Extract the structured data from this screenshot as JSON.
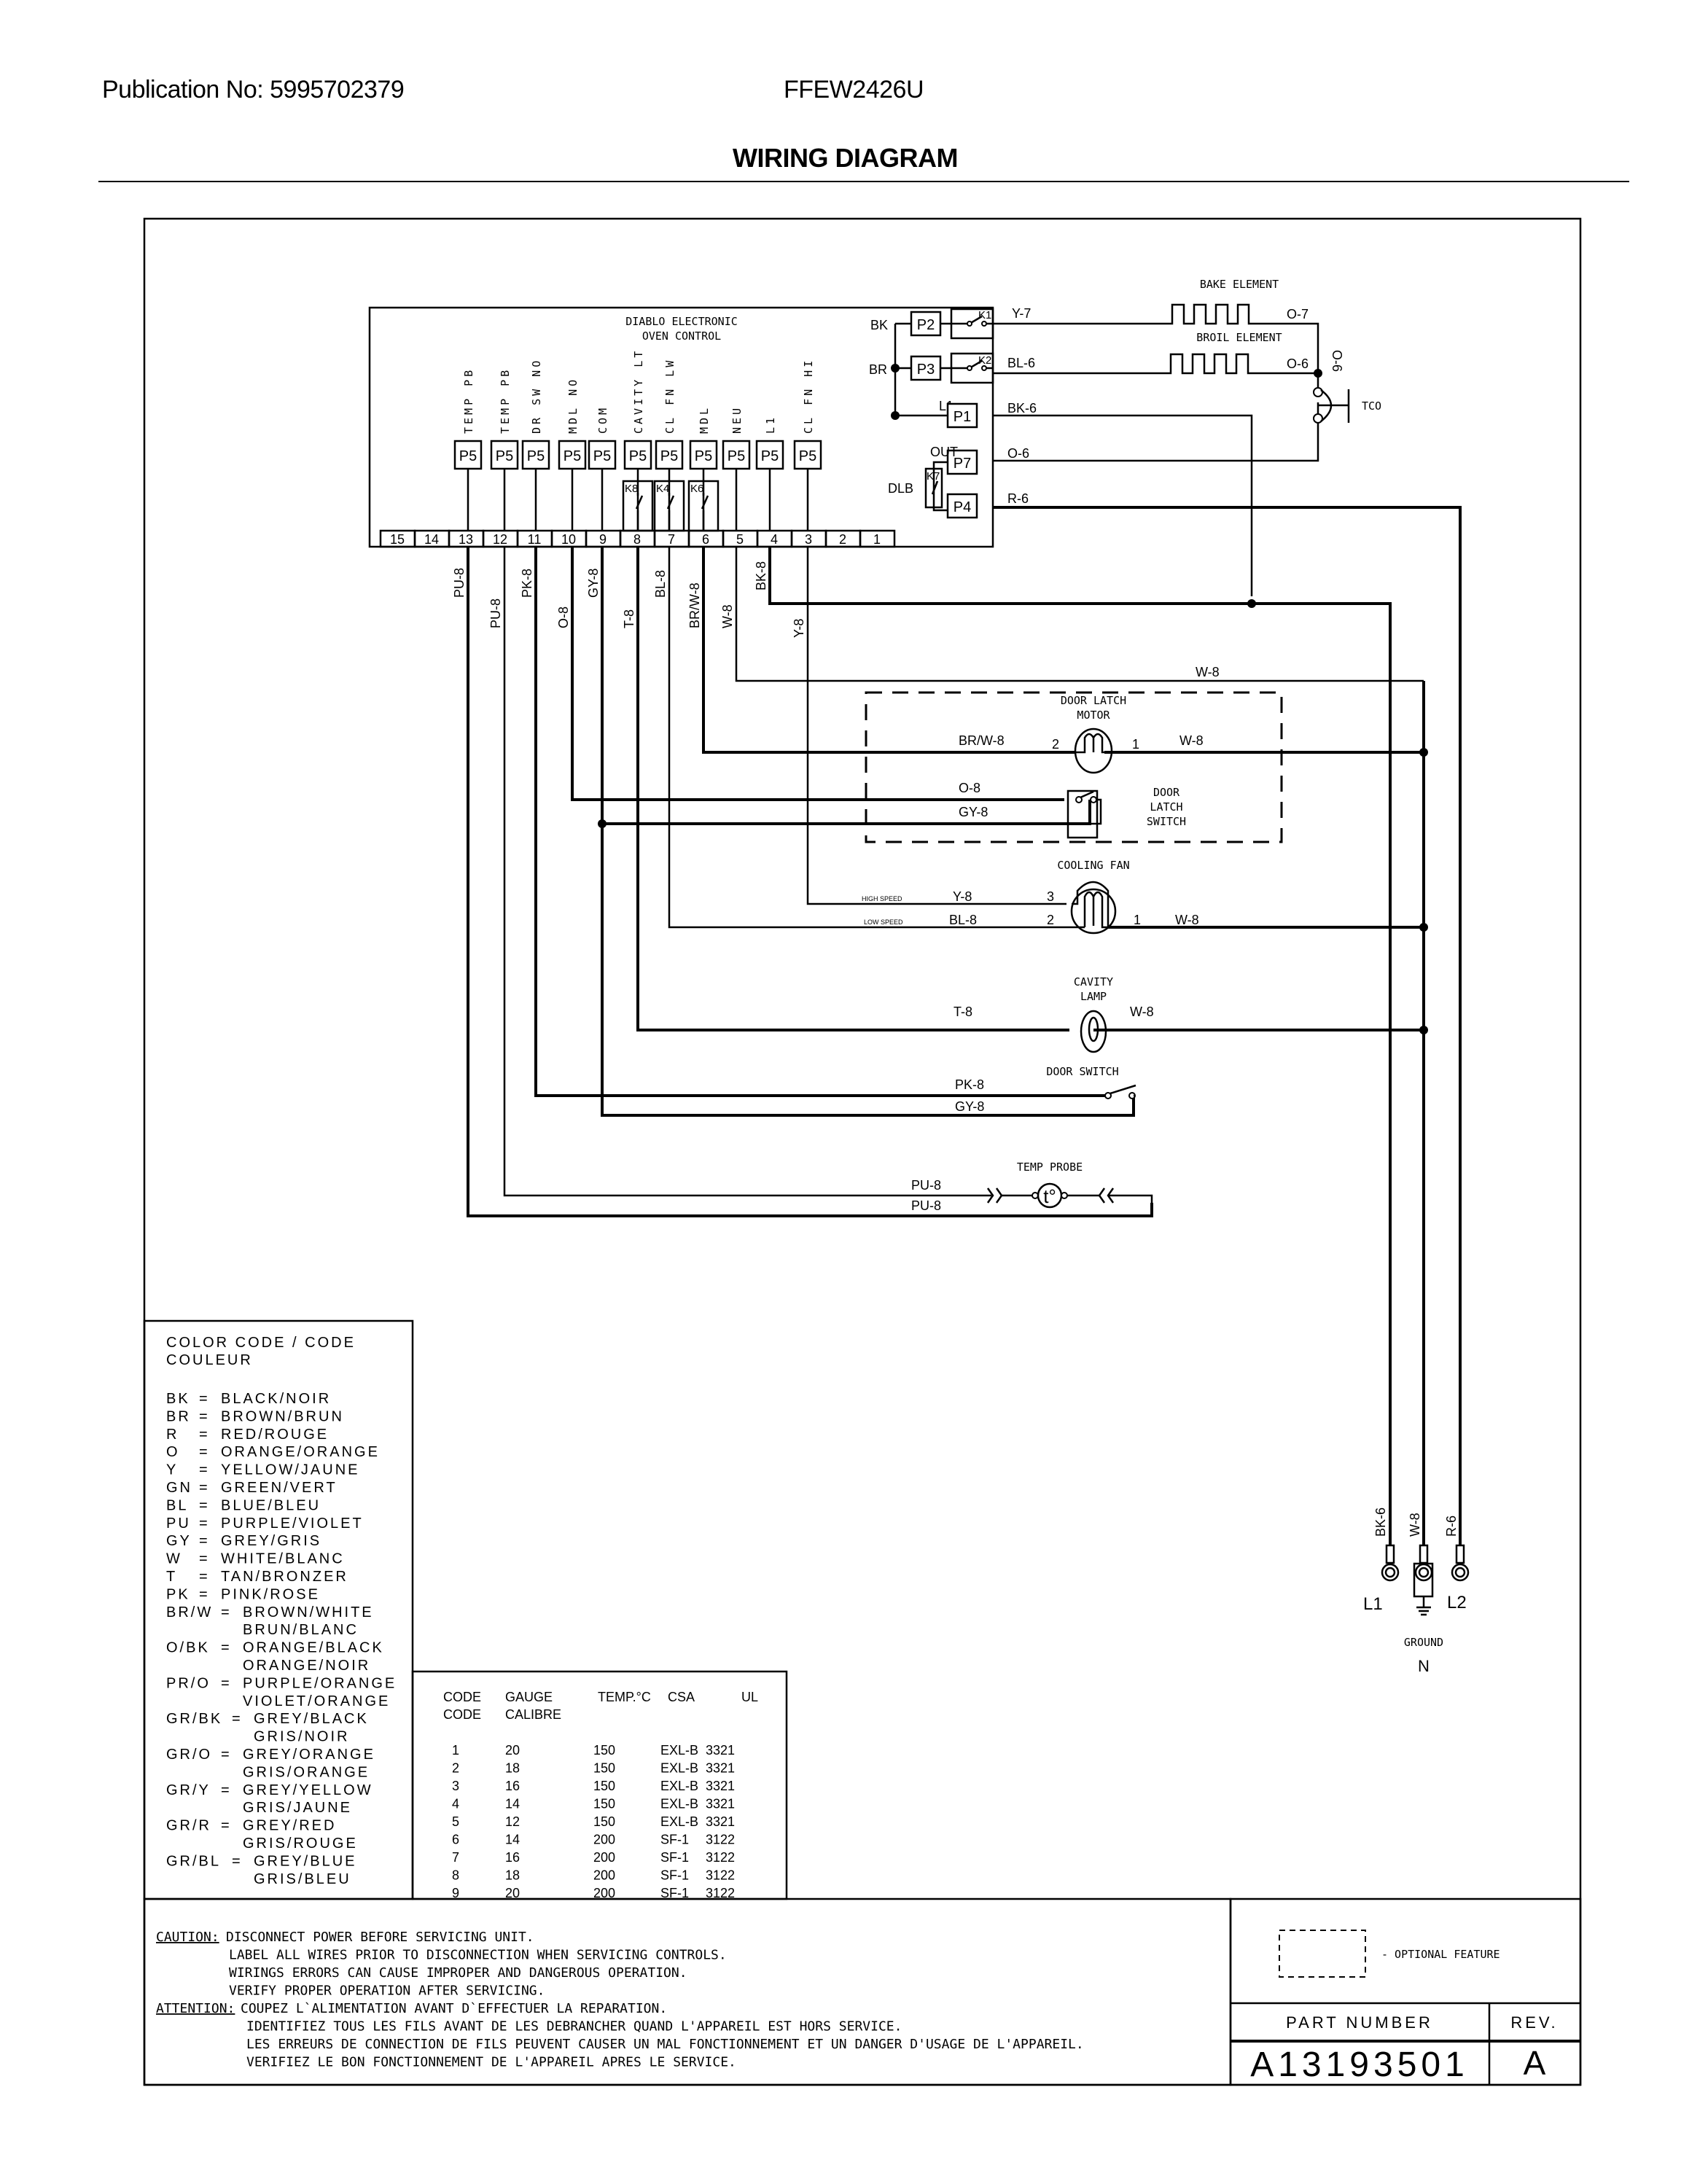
{
  "header": {
    "publication": "Publication No: 5995702379",
    "model": "FFEW2426U",
    "title": "WIRING DIAGRAM"
  },
  "control": {
    "title_line1": "DIABLO ELECTRONIC",
    "title_line2": "OVEN CONTROL",
    "p5_connector_label": "P5",
    "p5_pins": [
      {
        "pin": "13",
        "function": "TEMP PB",
        "wire": "PU-8"
      },
      {
        "pin": "12",
        "function": "TEMP PB",
        "wire": "PU-8"
      },
      {
        "pin": "11",
        "function": "DR SW NO",
        "wire": "PK-8"
      },
      {
        "pin": "10",
        "function": "MDL NO",
        "wire": "O-8"
      },
      {
        "pin": "9",
        "function": "COM",
        "wire": "GY-8"
      },
      {
        "pin": "8",
        "function": "CAVITY LT",
        "wire": "T-8",
        "relay": "K8"
      },
      {
        "pin": "7",
        "function": "CL FN LW",
        "wire": "BL-8",
        "relay": "K4"
      },
      {
        "pin": "6",
        "function": "MDL",
        "wire": "BR/W-8",
        "relay": "K6"
      },
      {
        "pin": "5",
        "function": "NEU",
        "wire": "W-8"
      },
      {
        "pin": "4",
        "function": "L1",
        "wire": "BK-8"
      },
      {
        "pin": "3",
        "function": "CL FN HI",
        "wire": "Y-8"
      }
    ],
    "terminal_numbers": [
      "15",
      "14",
      "13",
      "12",
      "11",
      "10",
      "9",
      "8",
      "7",
      "6",
      "5",
      "4",
      "3",
      "2",
      "1"
    ],
    "connectors": {
      "bk": "BK",
      "br": "BR",
      "l1": "L1",
      "out": "OUT",
      "dlb": "DLB",
      "p1": "P1",
      "p2": "P2",
      "p3": "P3",
      "p4": "P4",
      "p7": "P7",
      "k1": "K1",
      "k2": "K2",
      "k7": "K7"
    }
  },
  "wires": {
    "y7": "Y-7",
    "bl6": "BL-6",
    "bk6": "BK-6",
    "o6": "O-6",
    "r6": "R-6",
    "o7": "O-7",
    "o6_right": "O-6",
    "o6_vert": "O-6",
    "w8": "W-8",
    "brw8": "BR/W-8",
    "o8": "O-8",
    "gy8": "GY-8",
    "y8": "Y-8",
    "bl8": "BL-8",
    "t8": "T-8",
    "pk8": "PK-8",
    "pu8": "PU-8"
  },
  "components": {
    "bake_element": "BAKE ELEMENT",
    "broil_element": "BROIL ELEMENT",
    "tco": "TCO",
    "door_latch_motor_1": "DOOR LATCH",
    "door_latch_motor_2": "MOTOR",
    "door_latch_switch_1": "DOOR",
    "door_latch_switch_2": "LATCH",
    "door_latch_switch_3": "SWITCH",
    "cooling_fan": "COOLING FAN",
    "high_speed": "HIGH SPEED",
    "low_speed": "LOW SPEED",
    "cavity_lamp_1": "CAVITY",
    "cavity_lamp_2": "LAMP",
    "door_switch": "DOOR SWITCH",
    "temp_probe": "TEMP PROBE",
    "temp_probe_symbol": "t°",
    "pin1": "1",
    "pin2": "2",
    "pin3": "3"
  },
  "supply": {
    "l1": "L1",
    "l2": "L2",
    "n": "N",
    "ground": "GROUND",
    "wire_l1": "BK-6",
    "wire_n": "W-8",
    "wire_l2": "R-6"
  },
  "color_code": {
    "title_line1": "COLOR CODE / CODE",
    "title_line2": "COULEUR",
    "entries": [
      {
        "code": "BK",
        "meaning": "BLACK/NOIR"
      },
      {
        "code": "BR",
        "meaning": "BROWN/BRUN"
      },
      {
        "code": "R",
        "meaning": "RED/ROUGE"
      },
      {
        "code": "O",
        "meaning": "ORANGE/ORANGE"
      },
      {
        "code": "Y",
        "meaning": "YELLOW/JAUNE"
      },
      {
        "code": "GN",
        "meaning": "GREEN/VERT"
      },
      {
        "code": "BL",
        "meaning": "BLUE/BLEU"
      },
      {
        "code": "PU",
        "meaning": "PURPLE/VIOLET"
      },
      {
        "code": "GY",
        "meaning": "GREY/GRIS"
      },
      {
        "code": "W",
        "meaning": "WHITE/BLANC"
      },
      {
        "code": "T",
        "meaning": "TAN/BRONZER"
      },
      {
        "code": "PK",
        "meaning": "PINK/ROSE"
      },
      {
        "code": "BR/W",
        "meaning": "BROWN/WHITE",
        "meaning_fr": "BRUN/BLANC"
      },
      {
        "code": "O/BK",
        "meaning": "ORANGE/BLACK",
        "meaning_fr": "ORANGE/NOIR"
      },
      {
        "code": "PR/O",
        "meaning": "PURPLE/ORANGE",
        "meaning_fr": "VIOLET/ORANGE"
      },
      {
        "code": "GR/BK",
        "meaning": "GREY/BLACK",
        "meaning_fr": "GRIS/NOIR"
      },
      {
        "code": "GR/O",
        "meaning": "GREY/ORANGE",
        "meaning_fr": "GRIS/ORANGE"
      },
      {
        "code": "GR/Y",
        "meaning": "GREY/YELLOW",
        "meaning_fr": "GRIS/JAUNE"
      },
      {
        "code": "GR/R",
        "meaning": "GREY/RED",
        "meaning_fr": "GRIS/ROUGE"
      },
      {
        "code": "GR/BL",
        "meaning": "GREY/BLUE",
        "meaning_fr": "GRIS/BLEU"
      }
    ]
  },
  "gauge_table": {
    "headers": [
      "CODE",
      "GAUGE",
      "TEMP.°C",
      "CSA",
      "UL"
    ],
    "headers_fr": [
      "CODE",
      "CALIBRE",
      "",
      "",
      ""
    ],
    "rows": [
      [
        "1",
        "20",
        "150",
        "EXL-B",
        "3321"
      ],
      [
        "2",
        "18",
        "150",
        "EXL-B",
        "3321"
      ],
      [
        "3",
        "16",
        "150",
        "EXL-B",
        "3321"
      ],
      [
        "4",
        "14",
        "150",
        "EXL-B",
        "3321"
      ],
      [
        "5",
        "12",
        "150",
        "EXL-B",
        "3321"
      ],
      [
        "6",
        "14",
        "200",
        "SF-1",
        "3122"
      ],
      [
        "7",
        "16",
        "200",
        "SF-1",
        "3122"
      ],
      [
        "8",
        "18",
        "200",
        "SF-1",
        "3122"
      ],
      [
        "9",
        "20",
        "200",
        "SF-1",
        "3122"
      ]
    ]
  },
  "notes": {
    "caution_label": "CAUTION:",
    "caution_lines": [
      "DISCONNECT POWER BEFORE SERVICING UNIT.",
      "LABEL ALL WIRES PRIOR TO DISCONNECTION WHEN SERVICING CONTROLS.",
      "WIRINGS ERRORS CAN CAUSE IMPROPER AND DANGEROUS OPERATION.",
      "VERIFY PROPER OPERATION AFTER SERVICING."
    ],
    "attention_label": "ATTENTION:",
    "attention_lines": [
      "COUPEZ L`ALIMENTATION AVANT D`EFFECTUER LA REPARATION.",
      "IDENTIFIEZ TOUS LES FILS AVANT DE LES DEBRANCHER QUAND L'APPAREIL EST HORS SERVICE.",
      "LES ERREURS DE CONNECTION DE FILS PEUVENT CAUSER UN MAL FONCTIONNEMENT ET UN DANGER D'USAGE DE L'APPAREIL.",
      "VERIFIEZ LE BON FONCTIONNEMENT DE L'APPAREIL APRES LE SERVICE."
    ]
  },
  "legend": {
    "optional_feature": "- OPTIONAL FEATURE"
  },
  "title_block": {
    "part_number_label": "PART NUMBER",
    "part_number": "A13193501",
    "rev_label": "REV.",
    "rev": "A"
  }
}
